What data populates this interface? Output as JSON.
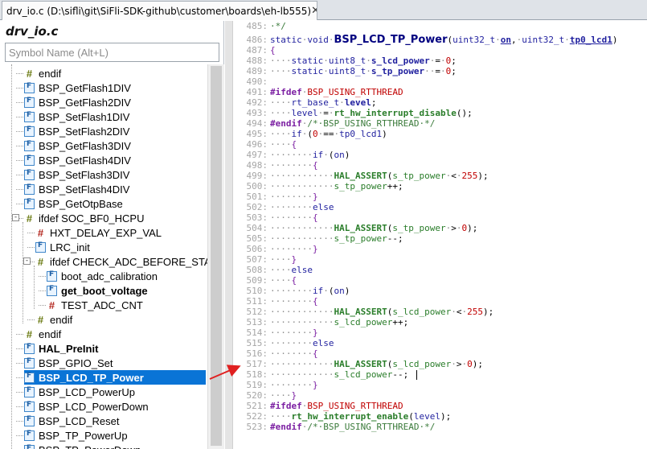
{
  "tab": {
    "title": "drv_io.c (D:\\sifli\\git\\SiFli-SDK-github\\customer\\boards\\eh-lb555)",
    "close_glyph": "✕"
  },
  "symbol_window": {
    "title": "drv_io.c",
    "search_placeholder": "Symbol Name (Alt+L)",
    "items": [
      {
        "label": "endif",
        "icon": "preprocessor-icon",
        "depth": 1
      },
      {
        "label": "BSP_GetFlash1DIV",
        "icon": "function-icon",
        "depth": 1
      },
      {
        "label": "BSP_GetFlash2DIV",
        "icon": "function-icon",
        "depth": 1
      },
      {
        "label": "BSP_SetFlash1DIV",
        "icon": "function-icon",
        "depth": 1
      },
      {
        "label": "BSP_SetFlash2DIV",
        "icon": "function-icon",
        "depth": 1
      },
      {
        "label": "BSP_GetFlash3DIV",
        "icon": "function-icon",
        "depth": 1
      },
      {
        "label": "BSP_GetFlash4DIV",
        "icon": "function-icon",
        "depth": 1
      },
      {
        "label": "BSP_SetFlash3DIV",
        "icon": "function-icon",
        "depth": 1
      },
      {
        "label": "BSP_SetFlash4DIV",
        "icon": "function-icon",
        "depth": 1
      },
      {
        "label": "BSP_GetOtpBase",
        "icon": "function-icon",
        "depth": 1
      },
      {
        "label": "ifdef SOC_BF0_HCPU",
        "icon": "preprocessor-icon",
        "depth": 1,
        "expander": "-"
      },
      {
        "label": "HXT_DELAY_EXP_VAL",
        "icon": "macro-icon",
        "depth": 2
      },
      {
        "label": "LRC_init",
        "icon": "function-icon",
        "depth": 2
      },
      {
        "label": "ifdef CHECK_ADC_BEFORE_START",
        "icon": "preprocessor-icon",
        "depth": 2,
        "expander": "-"
      },
      {
        "label": "boot_adc_calibration",
        "icon": "function-icon",
        "depth": 3
      },
      {
        "label": "get_boot_voltage",
        "icon": "function-icon",
        "depth": 3,
        "bold": true
      },
      {
        "label": "TEST_ADC_CNT",
        "icon": "macro-icon",
        "depth": 3
      },
      {
        "label": "endif",
        "icon": "preprocessor-icon",
        "depth": 2
      },
      {
        "label": "endif",
        "icon": "preprocessor-icon",
        "depth": 1
      },
      {
        "label": "HAL_PreInit",
        "icon": "function-icon",
        "depth": 1,
        "bold": true
      },
      {
        "label": "BSP_GPIO_Set",
        "icon": "function-icon",
        "depth": 1
      },
      {
        "label": "BSP_LCD_TP_Power",
        "icon": "function-icon",
        "depth": 1,
        "selected": true
      },
      {
        "label": "BSP_LCD_PowerUp",
        "icon": "function-icon",
        "depth": 1
      },
      {
        "label": "BSP_LCD_PowerDown",
        "icon": "function-icon",
        "depth": 1
      },
      {
        "label": "BSP_LCD_Reset",
        "icon": "function-icon",
        "depth": 1
      },
      {
        "label": "BSP_TP_PowerUp",
        "icon": "function-icon",
        "depth": 1
      },
      {
        "label": "BSP_TP_PowerDown",
        "icon": "function-icon",
        "depth": 1
      }
    ]
  },
  "editor": {
    "lines": [
      {
        "n": "485:",
        "segs": [
          [
            "cmt",
            "·*/"
          ]
        ]
      },
      {
        "n": "486:",
        "segs": [
          [
            "kw",
            "static"
          ],
          [
            "code",
            "·"
          ],
          [
            "kw",
            "void"
          ],
          [
            "code",
            "·"
          ],
          [
            "fnd",
            "BSP_LCD_TP_Power"
          ],
          [
            "txt",
            "("
          ],
          [
            "typ",
            "uint32_t"
          ],
          [
            "code",
            "·"
          ],
          [
            "prm",
            "on"
          ],
          [
            "txt",
            ","
          ],
          [
            "code",
            "·"
          ],
          [
            "typ",
            "uint32_t"
          ],
          [
            "code",
            "·"
          ],
          [
            "prm",
            "tp0_lcd1"
          ],
          [
            "txt",
            ")"
          ]
        ]
      },
      {
        "n": "487:",
        "segs": [
          [
            "brace",
            "{"
          ]
        ]
      },
      {
        "n": "488:",
        "segs": [
          [
            "code",
            "····"
          ],
          [
            "kw",
            "static"
          ],
          [
            "code",
            "·"
          ],
          [
            "typ",
            "uint8_t"
          ],
          [
            "code",
            "·"
          ],
          [
            "gl",
            "s_lcd_power"
          ],
          [
            "code",
            "·"
          ],
          [
            "txt",
            "="
          ],
          [
            "code",
            "·"
          ],
          [
            "num",
            "0"
          ],
          [
            "txt",
            ";"
          ]
        ]
      },
      {
        "n": "489:",
        "segs": [
          [
            "code",
            "····"
          ],
          [
            "kw",
            "static"
          ],
          [
            "code",
            "·"
          ],
          [
            "typ",
            "uint8_t"
          ],
          [
            "code",
            "·"
          ],
          [
            "gl",
            "s_tp_power"
          ],
          [
            "code",
            "··"
          ],
          [
            "txt",
            "="
          ],
          [
            "code",
            "·"
          ],
          [
            "num",
            "0"
          ],
          [
            "txt",
            ";"
          ]
        ]
      },
      {
        "n": "490:",
        "segs": []
      },
      {
        "n": "491:",
        "segs": [
          [
            "pp",
            "#ifdef"
          ],
          [
            "code",
            "·"
          ],
          [
            "ppm",
            "BSP_USING_RTTHREAD"
          ]
        ]
      },
      {
        "n": "492:",
        "segs": [
          [
            "code",
            "····"
          ],
          [
            "typ",
            "rt_base_t"
          ],
          [
            "code",
            "·"
          ],
          [
            "gl",
            "level"
          ],
          [
            "txt",
            ";"
          ]
        ]
      },
      {
        "n": "493:",
        "segs": [
          [
            "code",
            "····"
          ],
          [
            "typ",
            "level"
          ],
          [
            "code",
            "·"
          ],
          [
            "txt",
            "="
          ],
          [
            "code",
            "·"
          ],
          [
            "call",
            "rt_hw_interrupt_disable"
          ],
          [
            "txt",
            "();"
          ]
        ]
      },
      {
        "n": "494:",
        "segs": [
          [
            "pp",
            "#endif"
          ],
          [
            "code",
            "·"
          ],
          [
            "cmt",
            "/*·BSP_USING_RTTHREAD·*/"
          ]
        ]
      },
      {
        "n": "495:",
        "segs": [
          [
            "code",
            "····"
          ],
          [
            "kw",
            "if"
          ],
          [
            "code",
            "·"
          ],
          [
            "txt",
            "("
          ],
          [
            "num",
            "0"
          ],
          [
            "code",
            "·"
          ],
          [
            "txt",
            "=="
          ],
          [
            "code",
            "·"
          ],
          [
            "typ",
            "tp0_lcd1"
          ],
          [
            "txt",
            ")"
          ]
        ]
      },
      {
        "n": "496:",
        "segs": [
          [
            "code",
            "····"
          ],
          [
            "brace",
            "{"
          ]
        ]
      },
      {
        "n": "497:",
        "segs": [
          [
            "code",
            "········"
          ],
          [
            "kw",
            "if"
          ],
          [
            "code",
            "·"
          ],
          [
            "txt",
            "("
          ],
          [
            "typ",
            "on"
          ],
          [
            "txt",
            ")"
          ]
        ]
      },
      {
        "n": "498:",
        "segs": [
          [
            "code",
            "········"
          ],
          [
            "brace",
            "{"
          ]
        ]
      },
      {
        "n": "499:",
        "segs": [
          [
            "code",
            "············"
          ],
          [
            "call",
            "HAL_ASSERT"
          ],
          [
            "txt",
            "("
          ],
          [
            "var",
            "s_tp_power"
          ],
          [
            "code",
            "·"
          ],
          [
            "txt",
            "<"
          ],
          [
            "code",
            "·"
          ],
          [
            "num",
            "255"
          ],
          [
            "txt",
            ");"
          ]
        ]
      },
      {
        "n": "500:",
        "segs": [
          [
            "code",
            "············"
          ],
          [
            "var",
            "s_tp_power"
          ],
          [
            "txt",
            "++;"
          ]
        ]
      },
      {
        "n": "501:",
        "segs": [
          [
            "code",
            "········"
          ],
          [
            "brace",
            "}"
          ]
        ]
      },
      {
        "n": "502:",
        "segs": [
          [
            "code",
            "········"
          ],
          [
            "kw",
            "else"
          ]
        ]
      },
      {
        "n": "503:",
        "segs": [
          [
            "code",
            "········"
          ],
          [
            "brace",
            "{"
          ]
        ]
      },
      {
        "n": "504:",
        "segs": [
          [
            "code",
            "············"
          ],
          [
            "call",
            "HAL_ASSERT"
          ],
          [
            "txt",
            "("
          ],
          [
            "var",
            "s_tp_power"
          ],
          [
            "code",
            "·"
          ],
          [
            "txt",
            ">"
          ],
          [
            "code",
            "·"
          ],
          [
            "num",
            "0"
          ],
          [
            "txt",
            ");"
          ]
        ]
      },
      {
        "n": "505:",
        "segs": [
          [
            "code",
            "············"
          ],
          [
            "var",
            "s_tp_power"
          ],
          [
            "txt",
            "--;"
          ]
        ]
      },
      {
        "n": "506:",
        "segs": [
          [
            "code",
            "········"
          ],
          [
            "brace",
            "}"
          ]
        ]
      },
      {
        "n": "507:",
        "segs": [
          [
            "code",
            "····"
          ],
          [
            "brace",
            "}"
          ]
        ]
      },
      {
        "n": "508:",
        "segs": [
          [
            "code",
            "····"
          ],
          [
            "kw",
            "else"
          ]
        ]
      },
      {
        "n": "509:",
        "segs": [
          [
            "code",
            "····"
          ],
          [
            "brace",
            "{"
          ]
        ]
      },
      {
        "n": "510:",
        "segs": [
          [
            "code",
            "········"
          ],
          [
            "kw",
            "if"
          ],
          [
            "code",
            "·"
          ],
          [
            "txt",
            "("
          ],
          [
            "typ",
            "on"
          ],
          [
            "txt",
            ")"
          ]
        ]
      },
      {
        "n": "511:",
        "segs": [
          [
            "code",
            "········"
          ],
          [
            "brace",
            "{"
          ]
        ]
      },
      {
        "n": "512:",
        "segs": [
          [
            "code",
            "············"
          ],
          [
            "call",
            "HAL_ASSERT"
          ],
          [
            "txt",
            "("
          ],
          [
            "var",
            "s_lcd_power"
          ],
          [
            "code",
            "·"
          ],
          [
            "txt",
            "<"
          ],
          [
            "code",
            "·"
          ],
          [
            "num",
            "255"
          ],
          [
            "txt",
            ");"
          ]
        ]
      },
      {
        "n": "513:",
        "segs": [
          [
            "code",
            "············"
          ],
          [
            "var",
            "s_lcd_power"
          ],
          [
            "txt",
            "++;"
          ]
        ]
      },
      {
        "n": "514:",
        "segs": [
          [
            "code",
            "········"
          ],
          [
            "brace",
            "}"
          ]
        ]
      },
      {
        "n": "515:",
        "segs": [
          [
            "code",
            "········"
          ],
          [
            "kw",
            "else"
          ]
        ]
      },
      {
        "n": "516:",
        "segs": [
          [
            "code",
            "········"
          ],
          [
            "brace",
            "{"
          ]
        ]
      },
      {
        "n": "517:",
        "segs": [
          [
            "code",
            "············"
          ],
          [
            "call",
            "HAL_ASSERT"
          ],
          [
            "txt",
            "("
          ],
          [
            "var",
            "s_lcd_power"
          ],
          [
            "code",
            "·"
          ],
          [
            "txt",
            ">"
          ],
          [
            "code",
            "·"
          ],
          [
            "num",
            "0"
          ],
          [
            "txt",
            ");"
          ]
        ]
      },
      {
        "n": "518:",
        "segs": [
          [
            "code",
            "············"
          ],
          [
            "var",
            "s_lcd_power"
          ],
          [
            "txt",
            "--;"
          ]
        ]
      },
      {
        "n": "519:",
        "segs": [
          [
            "code",
            "········"
          ],
          [
            "brace",
            "}"
          ]
        ]
      },
      {
        "n": "520:",
        "segs": [
          [
            "code",
            "····"
          ],
          [
            "brace",
            "}"
          ]
        ]
      },
      {
        "n": "521:",
        "segs": [
          [
            "pp",
            "#ifdef"
          ],
          [
            "code",
            "·"
          ],
          [
            "ppm",
            "BSP_USING_RTTHREAD"
          ]
        ]
      },
      {
        "n": "522:",
        "segs": [
          [
            "code",
            "····"
          ],
          [
            "call",
            "rt_hw_interrupt_enable"
          ],
          [
            "txt",
            "("
          ],
          [
            "typ",
            "level"
          ],
          [
            "txt",
            ");"
          ]
        ]
      },
      {
        "n": "523:",
        "segs": [
          [
            "pp",
            "#endif"
          ],
          [
            "code",
            "·"
          ],
          [
            "cmt",
            "/*·BSP_USING_RTTHREAD·*/"
          ]
        ]
      }
    ]
  },
  "colors": {
    "selection": "#0a74d6",
    "arrow": "#e02020"
  }
}
